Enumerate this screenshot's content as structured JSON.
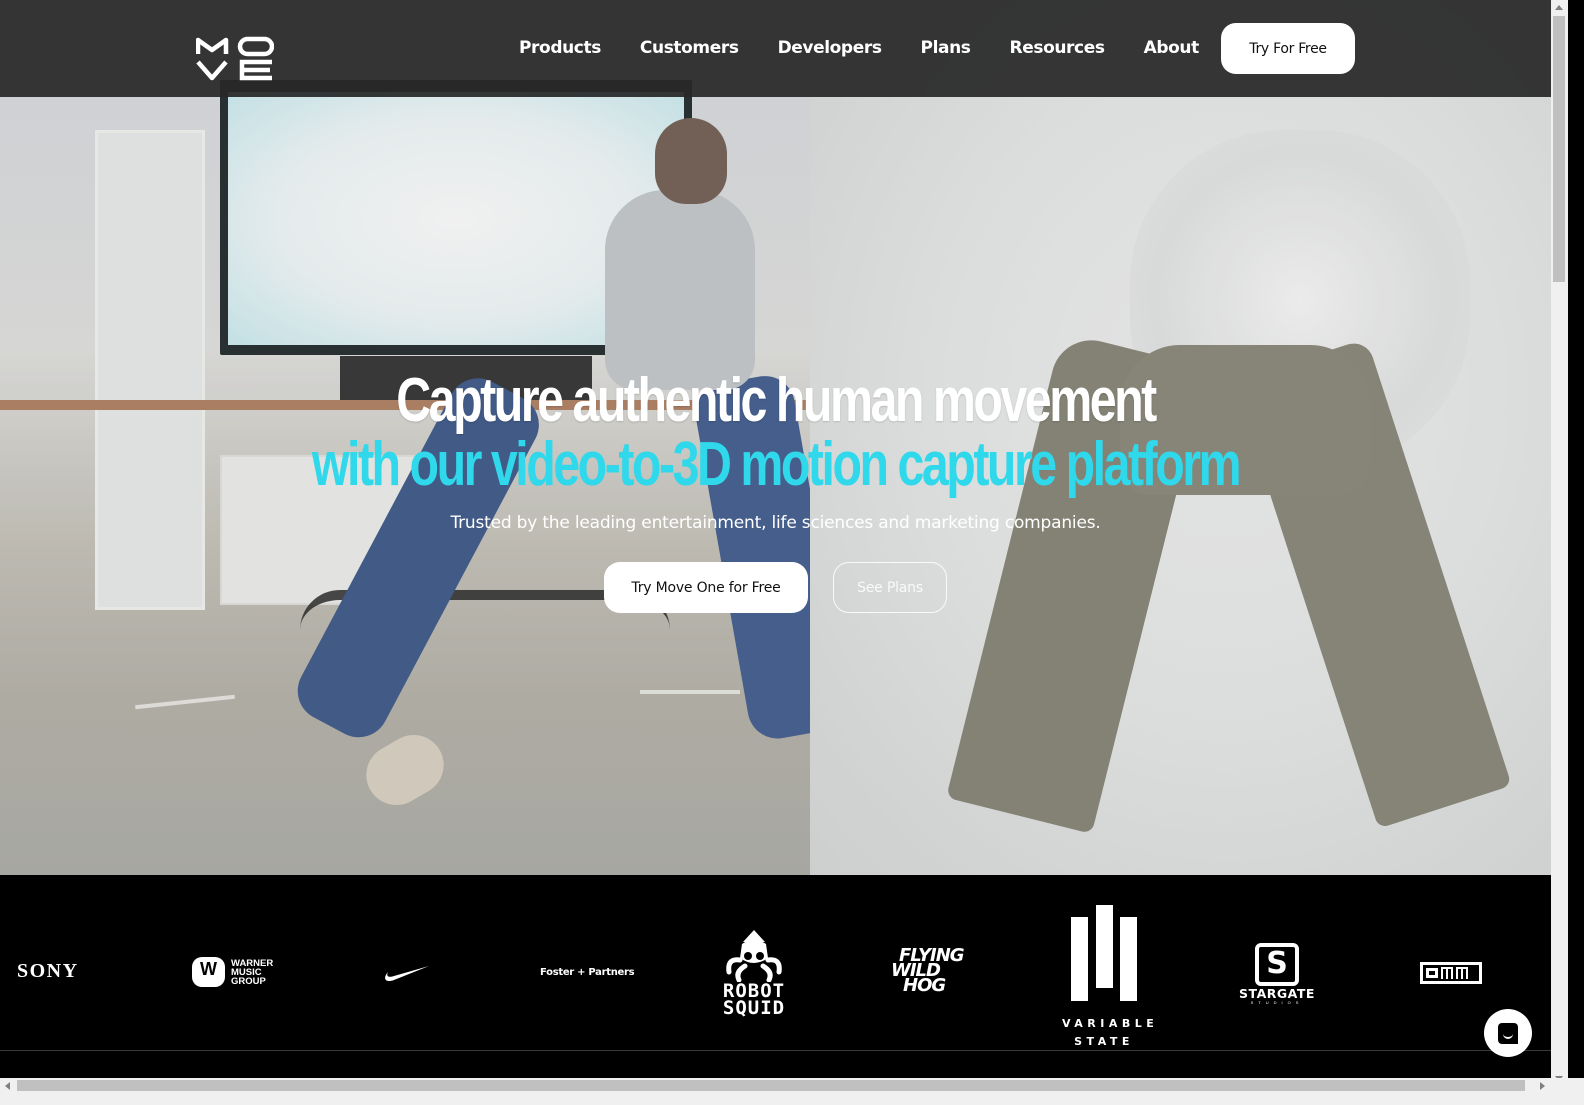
{
  "brand": {
    "logo_letters": [
      "M",
      "O",
      "V",
      "E"
    ],
    "name": "Move"
  },
  "nav": {
    "links": [
      "Products",
      "Customers",
      "Developers",
      "Plans",
      "Resources",
      "About"
    ],
    "cta_label": "Try For Free"
  },
  "hero": {
    "headline_line1": "Capture authentic human movement",
    "headline_line2": "with our video-to-3D motion capture platform",
    "subheadline": "Trusted by the leading entertainment, life sciences and marketing companies.",
    "primary_cta": "Try Move One for Free",
    "secondary_cta": "See Plans",
    "accent_color": "#2fd8ea"
  },
  "customers": {
    "sony": "SONY",
    "warner": [
      "WARNER",
      "MUSIC",
      "GROUP"
    ],
    "nike": "Nike",
    "foster": "Foster + Partners",
    "robot_squid": [
      "ROBOT",
      "SQUID"
    ],
    "flying_wild_hog": [
      "FLYING",
      "WILD",
      "HOG"
    ],
    "variable_state": [
      "VARIABLE",
      "STATE"
    ],
    "stargate": "STARGATE",
    "stargate_sub": "STUDIOS",
    "omm": "OMM"
  },
  "chat": {
    "icon": "chat-bubble-icon"
  }
}
